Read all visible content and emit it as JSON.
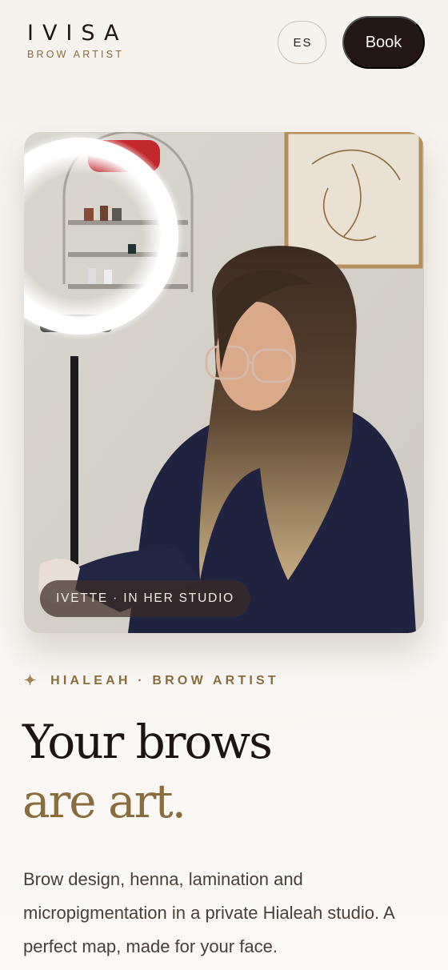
{
  "brand": {
    "name": "IVISA",
    "tagline": "BROW ARTIST"
  },
  "header": {
    "language_label": "ES",
    "book_label": "Book"
  },
  "hero": {
    "photo_caption": "IVETTE · IN HER STUDIO",
    "eyebrow_icon": "sparkle-icon",
    "eyebrow": "HIALEAH · BROW ARTIST",
    "headline_line1": "Your brows",
    "headline_line2": "are art.",
    "description": "Brow design, henna, lamination and micropigmentation in a private Hialeah studio. A perfect map, made for your face."
  },
  "colors": {
    "accent_gold": "#8a6c3e",
    "button_dark": "#221714",
    "background": "#f8f5f1"
  }
}
